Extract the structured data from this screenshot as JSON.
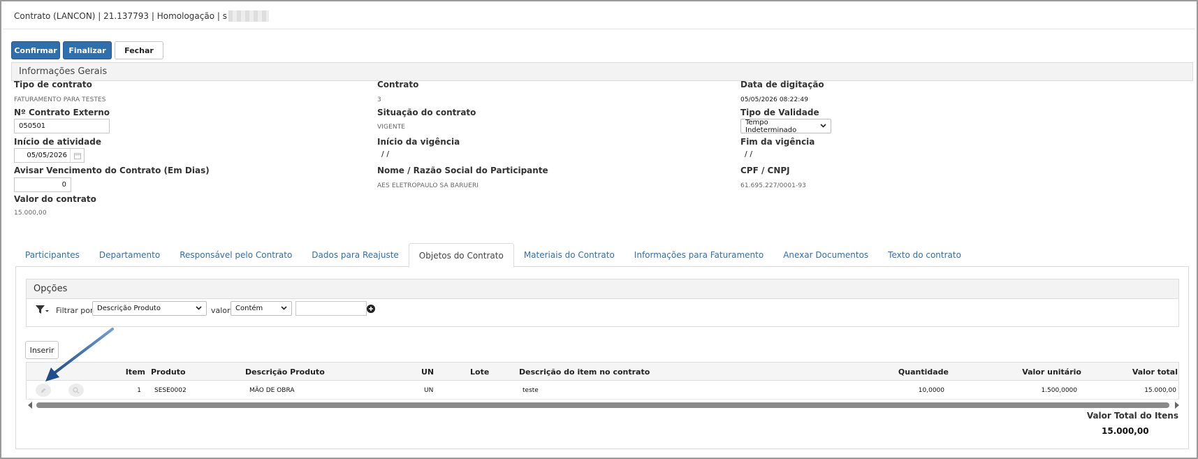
{
  "window": {
    "title": "Contrato (LANCON) | 21.137793 | Homologação | s"
  },
  "toolbar": {
    "confirm": "Confirmar",
    "finish": "Finalizar",
    "close": "Fechar"
  },
  "section": {
    "title": "Informações Gerais"
  },
  "fields": {
    "tipo_contrato": {
      "label": "Tipo de contrato",
      "value": "FATURAMENTO PARA TESTES"
    },
    "contrato": {
      "label": "Contrato",
      "value": "3"
    },
    "data_digitacao": {
      "label": "Data de digitação",
      "value": "05/05/2026 08:22:49"
    },
    "contrato_externo": {
      "label": "Nº Contrato Externo",
      "value": "050501"
    },
    "situacao": {
      "label": "Situação do contrato",
      "value": "VIGENTE"
    },
    "tipo_validade": {
      "label": "Tipo de Validade",
      "value": "Tempo Indeterminado"
    },
    "inicio_atividade": {
      "label": "Início de atividade",
      "value": "05/05/2026"
    },
    "inicio_vigencia": {
      "label": "Início da vigência",
      "value": " / /"
    },
    "fim_vigencia": {
      "label": "Fim da vigência",
      "value": " / /"
    },
    "avisar_vencimento": {
      "label": "Avisar Vencimento do Contrato (Em Dias)",
      "value": "0"
    },
    "participante": {
      "label": "Nome / Razão Social do Participante",
      "value": "AES ELETROPAULO SA BARUERI"
    },
    "cpf_cnpj": {
      "label": "CPF / CNPJ",
      "value": "61.695.227/0001-93"
    },
    "valor_contrato": {
      "label": "Valor do contrato",
      "value": "15.000,00"
    }
  },
  "tabs": [
    {
      "label": "Participantes",
      "active": false
    },
    {
      "label": "Departamento",
      "active": false
    },
    {
      "label": "Responsável pelo Contrato",
      "active": false
    },
    {
      "label": "Dados para Reajuste",
      "active": false
    },
    {
      "label": "Objetos do Contrato",
      "active": true
    },
    {
      "label": "Materiais do Contrato",
      "active": false
    },
    {
      "label": "Informações para Faturamento",
      "active": false
    },
    {
      "label": "Anexar Documentos",
      "active": false
    },
    {
      "label": "Texto do contrato",
      "active": false
    }
  ],
  "options": {
    "title": "Opções",
    "filter_label": "Filtrar por",
    "filter_field": "Descrição Produto",
    "value_label": "valor",
    "operator": "Contém",
    "search_value": ""
  },
  "grid": {
    "insert_label": "Inserir",
    "headers": {
      "item": "Item",
      "produto": "Produto",
      "descricao": "Descrição Produto",
      "un": "UN",
      "lote": "Lote",
      "descricao_item": "Descrição do item no contrato",
      "quantidade": "Quantidade",
      "valor_unitario": "Valor unitário",
      "valor_total": "Valor total"
    },
    "rows": [
      {
        "item": "1",
        "produto": "SESE0002",
        "descricao": "MÃO DE OBRA",
        "un": "UN",
        "lote": "",
        "descricao_item": "teste",
        "quantidade": "10,0000",
        "valor_unitario": "1.500,0000",
        "valor_total": "15.000,00"
      }
    ]
  },
  "totals": {
    "label": "Valor Total do Itens",
    "value": "15.000,00"
  },
  "colors": {
    "primary": "#2f6fae",
    "link": "#2f6fae",
    "annotation_arrow": "#1f4e8c"
  }
}
